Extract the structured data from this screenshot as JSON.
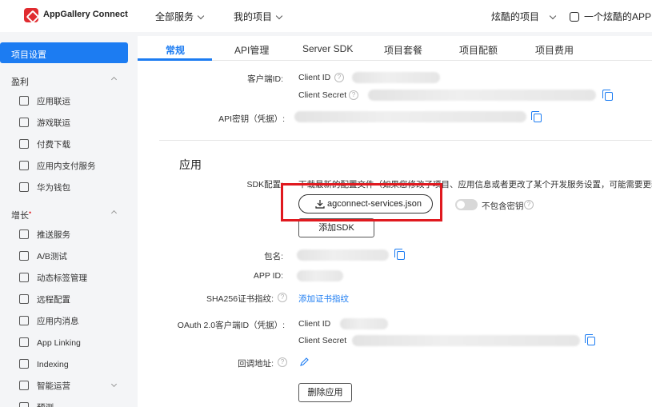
{
  "topbar": {
    "brand": "AppGallery Connect",
    "nav_all_services": "全部服务",
    "nav_my_projects": "我的项目",
    "project_name": "炫酷的项目",
    "app_name": "一个炫酷的APP"
  },
  "sidebar": {
    "active": "项目设置",
    "groups": [
      {
        "label": "盈利",
        "items": [
          "应用联运",
          "游戏联运",
          "付费下载",
          "应用内支付服务",
          "华为钱包"
        ]
      },
      {
        "label": "增长",
        "badge": "•",
        "items": [
          "推送服务",
          "A/B测试",
          "动态标签管理",
          "远程配置",
          "应用内消息",
          "App Linking",
          "Indexing",
          "智能运营",
          "预测"
        ]
      }
    ]
  },
  "tabs": [
    "常规",
    "API管理",
    "Server SDK",
    "项目套餐",
    "项目配额",
    "项目费用"
  ],
  "general": {
    "client_id_label": "客户端ID:",
    "client_id_key": "Client ID",
    "client_secret_key": "Client Secret",
    "api_key_label": "API密钥（凭据）:"
  },
  "app_section": {
    "title": "应用",
    "sdk_label": "SDK配置:",
    "sdk_hint": "下载最新的配置文件（如果您修改了项目、应用信息或者更改了某个开发服务设置，可能需要更新该文件）",
    "download_button": "agconnect-services.json",
    "toggle_label": "不包含密钥",
    "add_sdk_button": "添加SDK",
    "package_label": "包名:",
    "app_id_label": "APP ID:",
    "sha256_label": "SHA256证书指纹:",
    "add_fingerprint": "添加证书指纹",
    "oauth_label": "OAuth 2.0客户端ID（凭据）:",
    "oauth_client_id_key": "Client ID",
    "oauth_client_secret_key": "Client Secret",
    "callback_label": "回调地址:",
    "delete_button": "删除应用"
  },
  "colors": {
    "accent": "#1c7cf2",
    "highlight": "#e0191f",
    "brand": "#e02b2f"
  }
}
